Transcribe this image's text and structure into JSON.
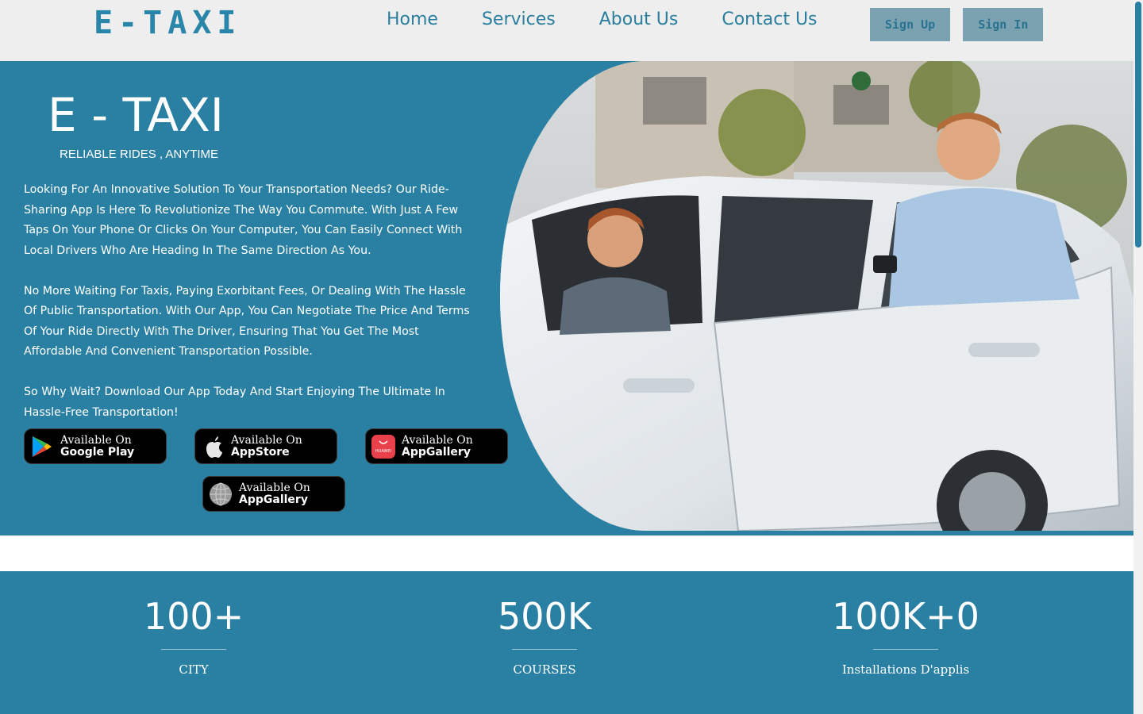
{
  "header": {
    "logo": "E-TAXI",
    "nav": [
      "Home",
      "Services",
      "About Us",
      "Contact Us"
    ],
    "sign_up": "Sign Up",
    "sign_in": "Sign In"
  },
  "hero": {
    "title": "E - TAXI",
    "tagline": "RELIABLE RIDES , ANYTIME",
    "paragraphs": [
      "Looking For An Innovative Solution To Your Transportation Needs? Our Ride-Sharing App Is Here To Revolutionize The Way You Commute. With Just A Few Taps On Your Phone Or Clicks On Your Computer, You Can Easily Connect With Local Drivers Who Are Heading In The Same Direction As You.",
      "No More Waiting For Taxis, Paying Exorbitant Fees, Or Dealing With The Hassle Of Public Transportation. With Our App, You Can Negotiate The Price And Terms Of Your Ride Directly With The Driver, Ensuring That You Get The Most Affordable And Convenient Transportation Possible.",
      "So Why Wait? Download Our App Today And Start Enjoying The Ultimate In Hassle-Free Transportation!"
    ],
    "stores": [
      {
        "small": "Available On",
        "big": "Google Play",
        "icon": "google-play-icon"
      },
      {
        "small": "Available On",
        "big": "AppStore",
        "icon": "apple-icon"
      },
      {
        "small": "Available On",
        "big": "AppGallery",
        "icon": "huawei-appgallery-icon",
        "icon_text": "HUAWEI"
      },
      {
        "small": "Available On",
        "big": "AppGallery",
        "icon": "globe-icon"
      }
    ]
  },
  "stats": [
    {
      "value": "100+",
      "label": "CITY"
    },
    {
      "value": "500K",
      "label": "COURSES"
    },
    {
      "value": "100K+0",
      "label": "Installations D'applis"
    }
  ],
  "colors": {
    "primary": "#2a80a3",
    "header_bg": "#eeeeee",
    "nav_text": "#2a7e9e",
    "auth_button_bg": "#7ba2b1"
  }
}
